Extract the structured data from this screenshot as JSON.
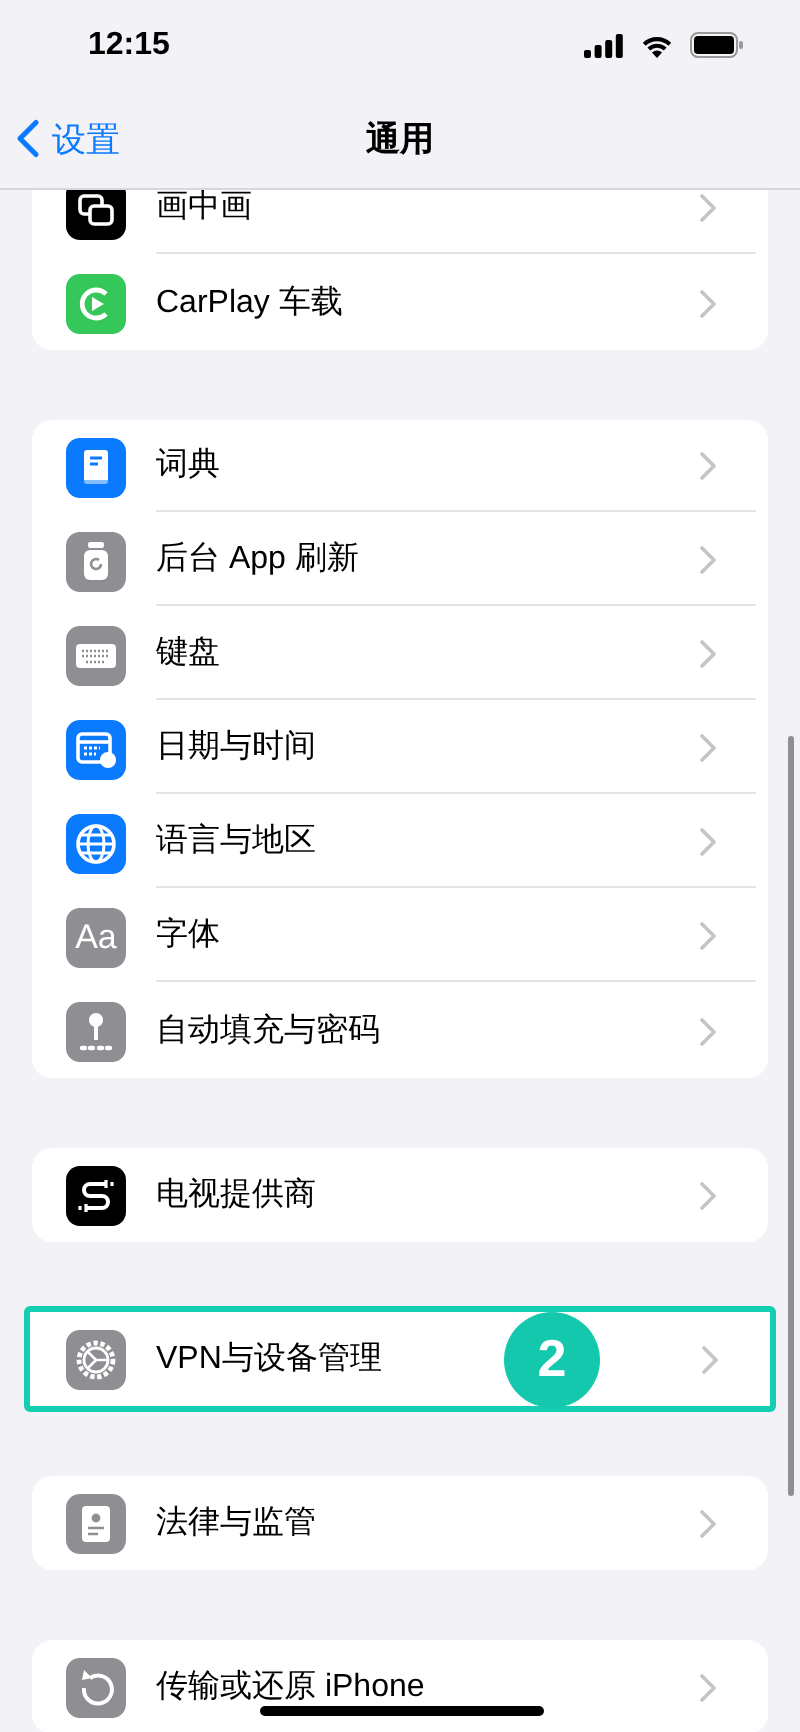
{
  "status_bar": {
    "time": "12:15"
  },
  "nav_bar": {
    "back": "设置",
    "title": "通用"
  },
  "groups": [
    {
      "highlighted": false,
      "rows": [
        {
          "label": "画中画",
          "kind": "pip",
          "color": "#000000"
        },
        {
          "label": "CarPlay 车载",
          "kind": "carplay",
          "color": "#34c759"
        }
      ]
    },
    {
      "highlighted": false,
      "rows": [
        {
          "label": "词典",
          "kind": "book",
          "color": "#0a7aff"
        },
        {
          "label": "后台 App 刷新",
          "kind": "refresh",
          "color": "#8e8e93"
        },
        {
          "label": "键盘",
          "kind": "keyboard",
          "color": "#8e8e93"
        },
        {
          "label": "日期与时间",
          "kind": "calendar",
          "color": "#0a7aff"
        },
        {
          "label": "语言与地区",
          "kind": "globe",
          "color": "#0a7aff"
        },
        {
          "label": "字体",
          "kind": "text",
          "icon_text": "Aa",
          "color": "#8e8e93"
        },
        {
          "label": "自动填充与密码",
          "kind": "key",
          "color": "#8e8e93"
        }
      ]
    },
    {
      "highlighted": false,
      "rows": [
        {
          "label": "电视提供商",
          "kind": "tv",
          "color": "#000000"
        }
      ]
    },
    {
      "highlighted": true,
      "badge": "2",
      "rows": [
        {
          "label": "VPN与设备管理",
          "kind": "gear",
          "color": "#8e8e93"
        }
      ]
    },
    {
      "highlighted": false,
      "rows": [
        {
          "label": "法律与监管",
          "kind": "legal",
          "color": "#8e8e93"
        }
      ]
    },
    {
      "highlighted": false,
      "rows": [
        {
          "label": "传输或还原 iPhone",
          "kind": "reset",
          "color": "#8e8e93"
        }
      ]
    }
  ]
}
